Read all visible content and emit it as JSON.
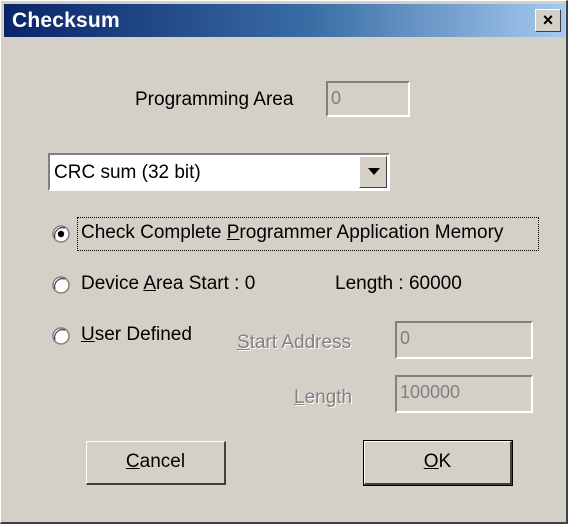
{
  "window": {
    "title": "Checksum",
    "close_glyph": "×"
  },
  "programming_area": {
    "label": "Programming Area",
    "value": "0"
  },
  "algorithm": {
    "selected": "CRC sum (32 bit)"
  },
  "options": {
    "complete_memory": {
      "label_pre": "Check Complete ",
      "label_ul": "P",
      "label_post": "rogrammer Application Memory",
      "checked": true
    },
    "device_area": {
      "label_pre": "Device ",
      "label_ul": "A",
      "label_post": "rea Start : 0",
      "length_text": "Length : 60000",
      "checked": false
    },
    "user_defined": {
      "label_ul": "U",
      "label_post": "ser Defined",
      "checked": false
    }
  },
  "user_range": {
    "start_label_ul": "S",
    "start_label_post": "tart Address",
    "start_value": "0",
    "length_label_ul": "L",
    "length_label_post": "ength",
    "length_value": "100000"
  },
  "buttons": {
    "cancel_ul": "C",
    "cancel_post": "ancel",
    "ok_ul": "O",
    "ok_post": "K"
  },
  "colors": {
    "face": "#d4d0c8",
    "title_start": "#0a246a",
    "title_end": "#a6caf0",
    "disabled_text": "#808080"
  }
}
